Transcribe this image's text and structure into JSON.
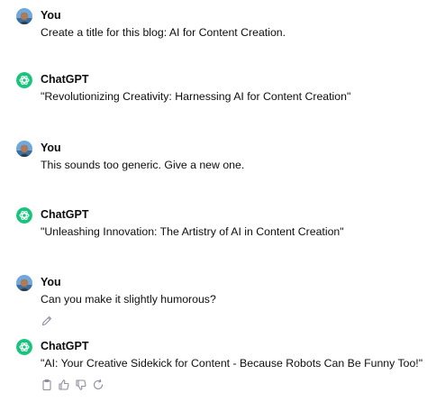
{
  "conversation": [
    {
      "author": "You",
      "text": "Create a title for this blog: AI for Content Creation."
    },
    {
      "author": "ChatGPT",
      "text": "\"Revolutionizing Creativity: Harnessing AI for Content Creation\""
    },
    {
      "author": "You",
      "text": "This sounds too generic. Give a new one."
    },
    {
      "author": "ChatGPT",
      "text": "\"Unleashing Innovation: The Artistry of AI in Content Creation\""
    },
    {
      "author": "You",
      "text": "Can you make it slightly humorous?"
    },
    {
      "author": "ChatGPT",
      "text": "\"AI: Your Creative Sidekick for Content - Because Robots Can Be Funny Too!\""
    }
  ],
  "icons": {
    "user_avatar": "user-avatar-icon",
    "assistant_avatar": "openai-logo-icon",
    "edit": "pencil-icon",
    "copy": "clipboard-icon",
    "like": "thumbs-up-icon",
    "dislike": "thumbs-down-icon",
    "regenerate": "refresh-icon"
  },
  "colors": {
    "assistant_avatar_bg": "#19c37d",
    "text": "#0d0d0d",
    "icon_gray": "#8e8ea0"
  }
}
